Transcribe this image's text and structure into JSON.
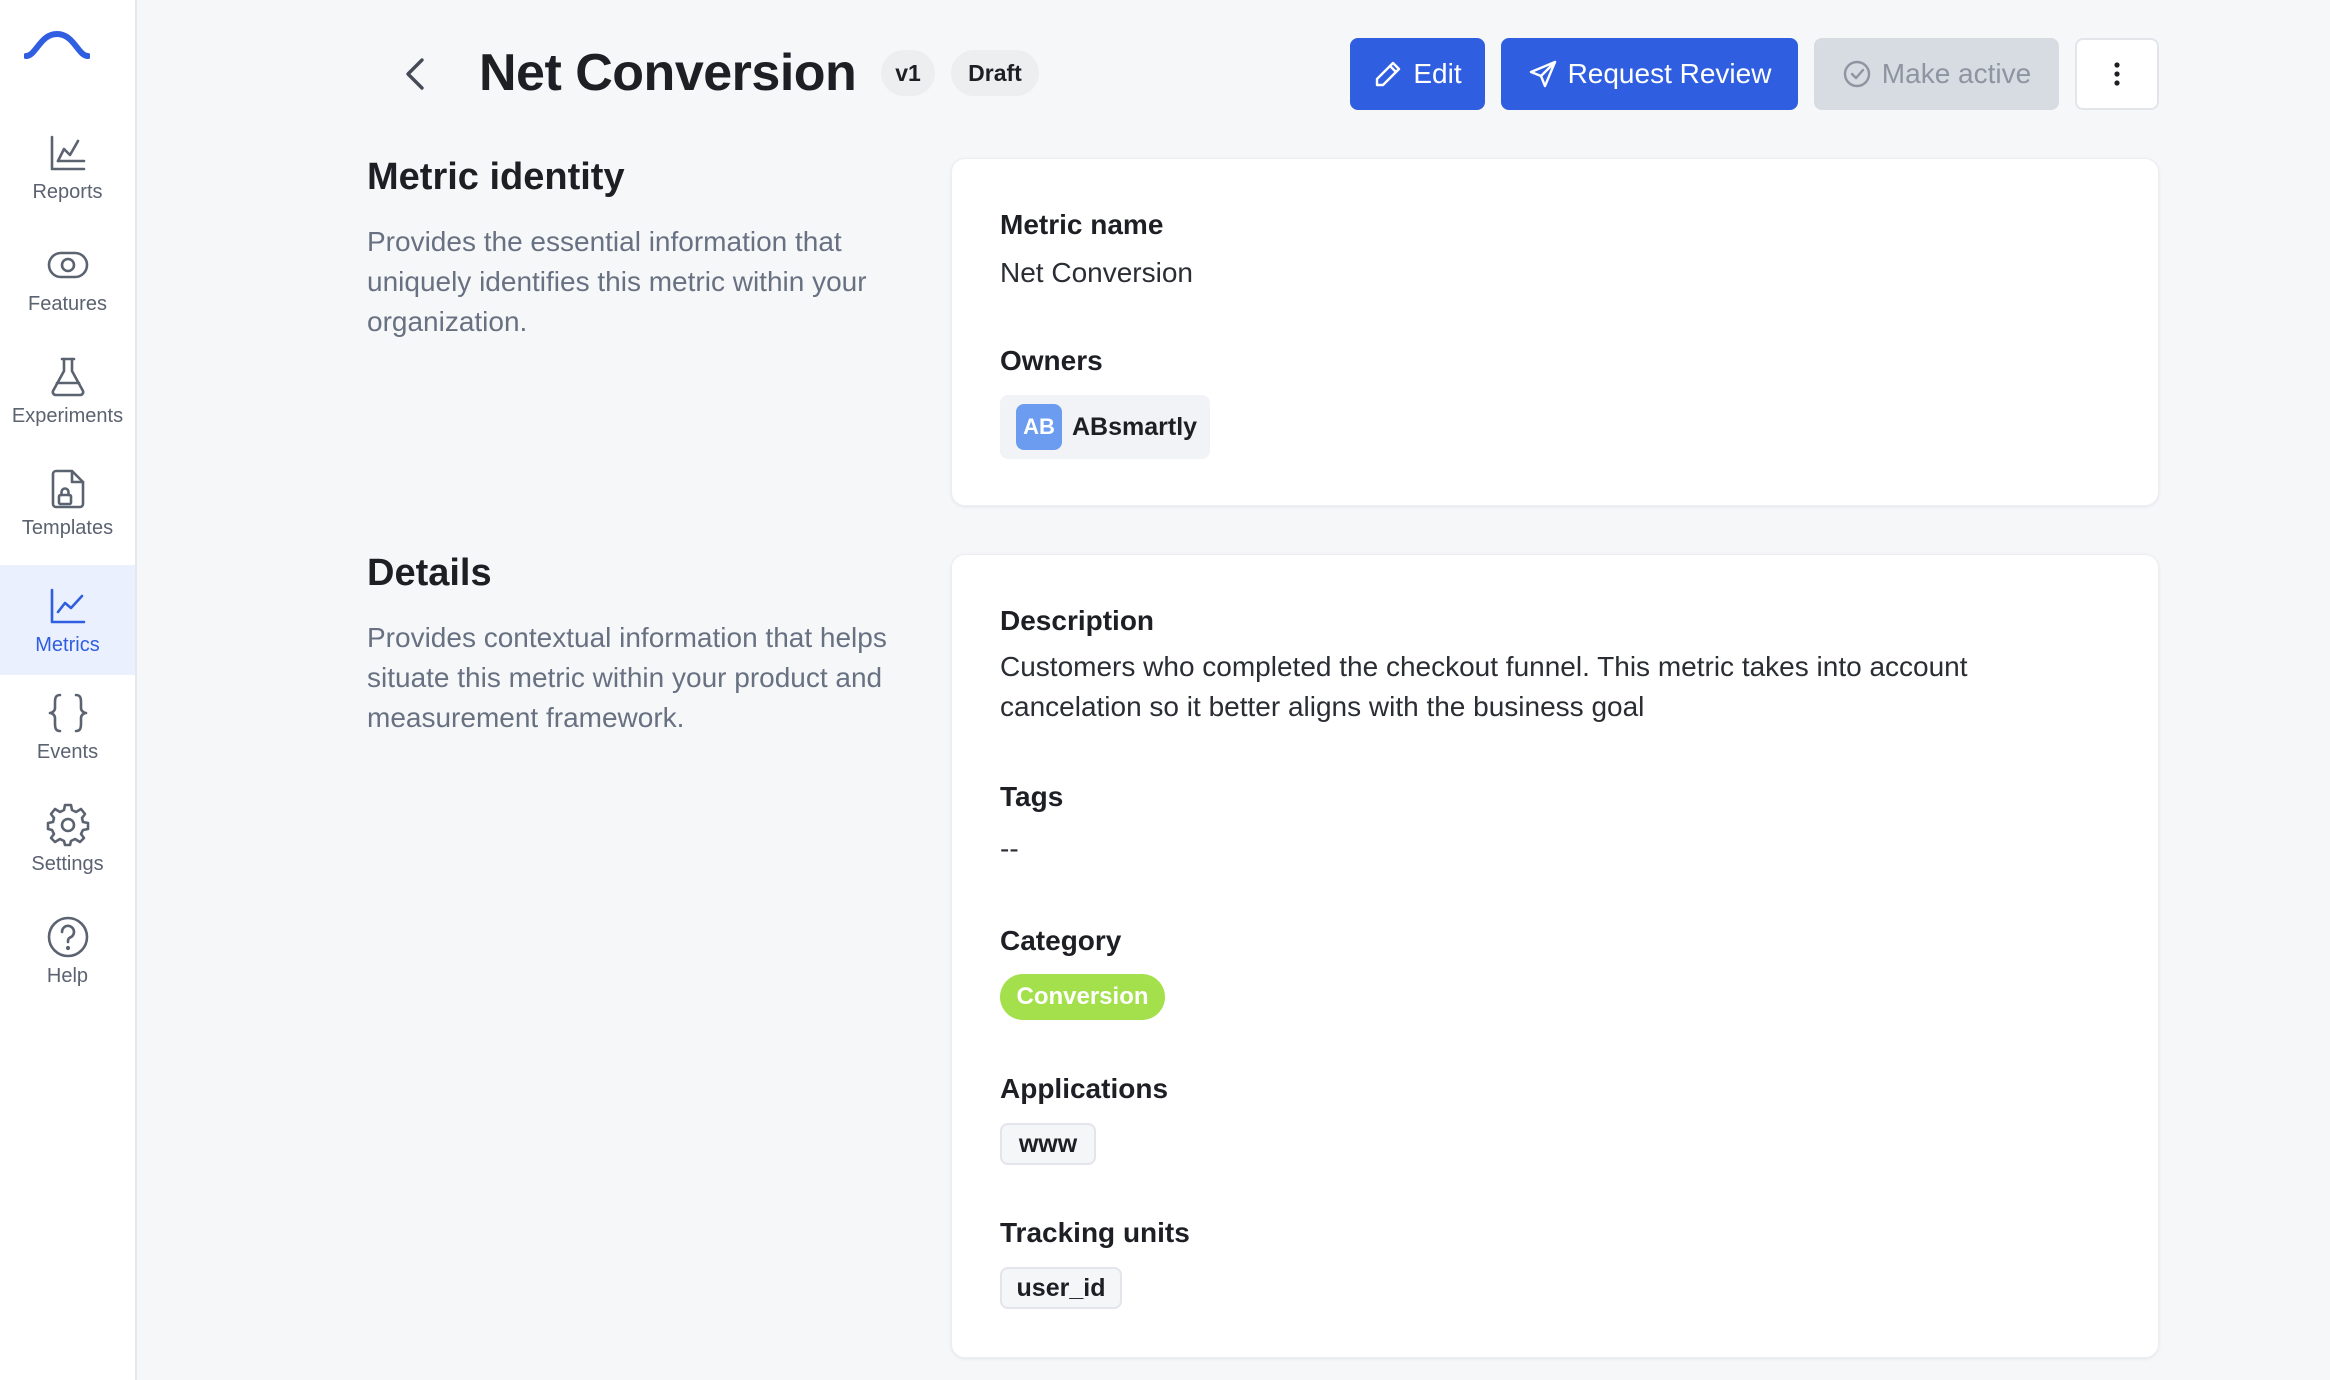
{
  "sidebar": {
    "logo": "absmartly-logo",
    "items": [
      {
        "label": "Reports",
        "icon": "chart-icon"
      },
      {
        "label": "Features",
        "icon": "eye-toggle-icon"
      },
      {
        "label": "Experiments",
        "icon": "flask-icon"
      },
      {
        "label": "Templates",
        "icon": "file-lock-icon"
      },
      {
        "label": "Metrics",
        "icon": "line-chart-icon",
        "active": true
      },
      {
        "label": "Events",
        "icon": "braces-icon"
      },
      {
        "label": "Settings",
        "icon": "gear-icon"
      },
      {
        "label": "Help",
        "icon": "help-circle-icon"
      }
    ]
  },
  "header": {
    "title": "Net Conversion",
    "version": "v1",
    "status": "Draft",
    "edit_label": "Edit",
    "request_review_label": "Request Review",
    "make_active_label": "Make active"
  },
  "identity": {
    "title": "Metric identity",
    "description": "Provides the essential information that uniquely identifies this metric within your organization.",
    "name_label": "Metric name",
    "name_value": "Net Conversion",
    "owners_label": "Owners",
    "owner": {
      "initials": "AB",
      "name": "ABsmartly"
    }
  },
  "details": {
    "title": "Details",
    "description": "Provides contextual information that helps situate this metric within your product and measurement framework.",
    "description_label": "Description",
    "description_value": "Customers who completed the checkout funnel. This metric takes into account cancelation so it better aligns with the business goal",
    "tags_label": "Tags",
    "tags_value": "--",
    "category_label": "Category",
    "category_value": "Conversion",
    "applications_label": "Applications",
    "applications_value": "www",
    "tracking_units_label": "Tracking units",
    "tracking_units_value": "user_id"
  },
  "colors": {
    "primary": "#2f5ee0",
    "category_badge": "#a3e04b",
    "active_nav_bg": "#eaf0fd"
  }
}
